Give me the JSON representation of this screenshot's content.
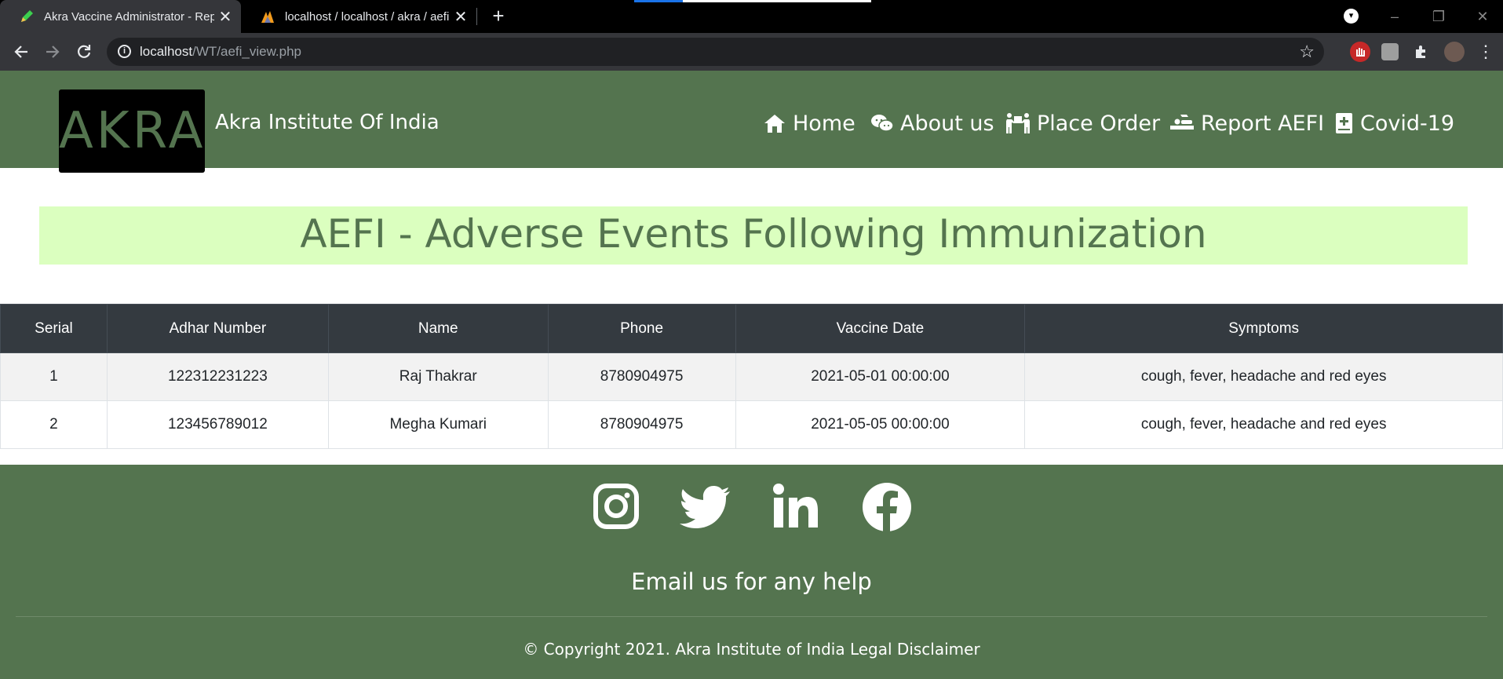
{
  "browser": {
    "tabs": [
      {
        "title": "Akra Vaccine Administrator - Rep",
        "active": true
      },
      {
        "title": "localhost / localhost / akra / aefi",
        "active": false
      }
    ],
    "close_glyph": "✕",
    "new_tab_glyph": "+",
    "url_host": "localhost",
    "url_path": "/WT/aefi_view.php",
    "window_controls": [
      "–",
      "❐",
      "✕"
    ]
  },
  "header": {
    "logo_text": "AKRA",
    "site_name": "Akra Institute Of India",
    "nav": [
      {
        "label": "Home",
        "icon": "home-icon"
      },
      {
        "label": "About us",
        "icon": "chat-icon"
      },
      {
        "label": "Place Order",
        "icon": "people-carry-icon"
      },
      {
        "label": "Report AEFI",
        "icon": "procedures-icon"
      },
      {
        "label": "Covid-19",
        "icon": "medical-book-icon"
      }
    ]
  },
  "banner": {
    "title": "AEFI - Adverse Events Following Immunization"
  },
  "table": {
    "columns": [
      "Serial",
      "Adhar Number",
      "Name",
      "Phone",
      "Vaccine Date",
      "Symptoms"
    ],
    "rows": [
      [
        "1",
        "122312231223",
        "Raj Thakrar",
        "8780904975",
        "2021-05-01 00:00:00",
        "cough, fever, headache and red eyes"
      ],
      [
        "2",
        "123456789012",
        "Megha Kumari",
        "8780904975",
        "2021-05-05 00:00:00",
        "cough, fever, headache and red eyes"
      ]
    ]
  },
  "footer": {
    "social": [
      "instagram-icon",
      "twitter-icon",
      "linkedin-icon",
      "facebook-icon"
    ],
    "email_help": "Email us for any help",
    "copyright": "© Copyright 2021. Akra Institute of India Legal Disclaimer"
  },
  "colors": {
    "brand_green": "#54744f",
    "banner_bg": "#dbffbf",
    "table_header": "#343a40"
  }
}
